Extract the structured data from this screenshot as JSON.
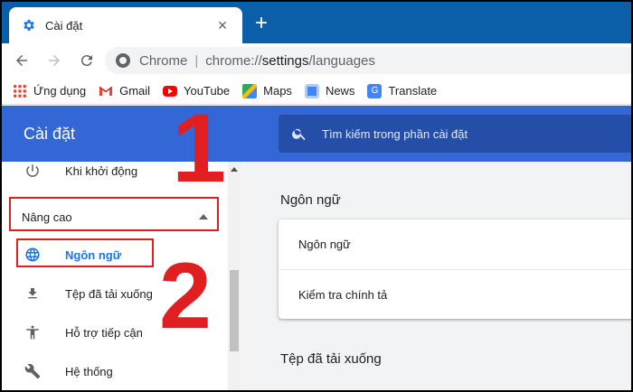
{
  "tab": {
    "title": "Cài đặt",
    "icon": "gear-icon"
  },
  "toolbar": {
    "back_icon": "back-arrow-icon",
    "forward_icon": "forward-arrow-icon",
    "reload_icon": "reload-icon",
    "omnibox": {
      "chip": "Chrome",
      "separator": "|",
      "scheme": "chrome://",
      "host": "settings",
      "path": "/languages"
    }
  },
  "bookmarks": [
    {
      "label": "Ứng dụng",
      "icon": "apps-icon"
    },
    {
      "label": "Gmail",
      "icon": "gmail-icon"
    },
    {
      "label": "YouTube",
      "icon": "youtube-icon"
    },
    {
      "label": "Maps",
      "icon": "maps-icon"
    },
    {
      "label": "News",
      "icon": "news-icon"
    },
    {
      "label": "Translate",
      "icon": "translate-icon"
    }
  ],
  "settings": {
    "title": "Cài đặt",
    "search_placeholder": "Tìm kiếm trong phần cài đặt"
  },
  "sidebar": {
    "items": [
      {
        "label": "Khi khởi động",
        "icon": "power-icon"
      },
      {
        "label": "Ngôn ngữ",
        "icon": "globe-icon",
        "active": true
      },
      {
        "label": "Tệp đã tải xuống",
        "icon": "download-icon"
      },
      {
        "label": "Hỗ trợ tiếp cận",
        "icon": "accessibility-icon"
      },
      {
        "label": "Hệ thống",
        "icon": "wrench-icon"
      }
    ],
    "advanced_label": "Nâng cao"
  },
  "main": {
    "languages_section_title": "Ngôn ngữ",
    "languages_card": [
      "Ngôn ngữ",
      "Kiểm tra chính tả"
    ],
    "downloads_section_title": "Tệp đã tải xuống"
  },
  "annotations": {
    "step1": "1",
    "step2": "2"
  },
  "colors": {
    "tabstrip": "#0b5fa8",
    "settings_header": "#3367d6",
    "accent": "#1a73e8",
    "annotation": "#e02020"
  }
}
